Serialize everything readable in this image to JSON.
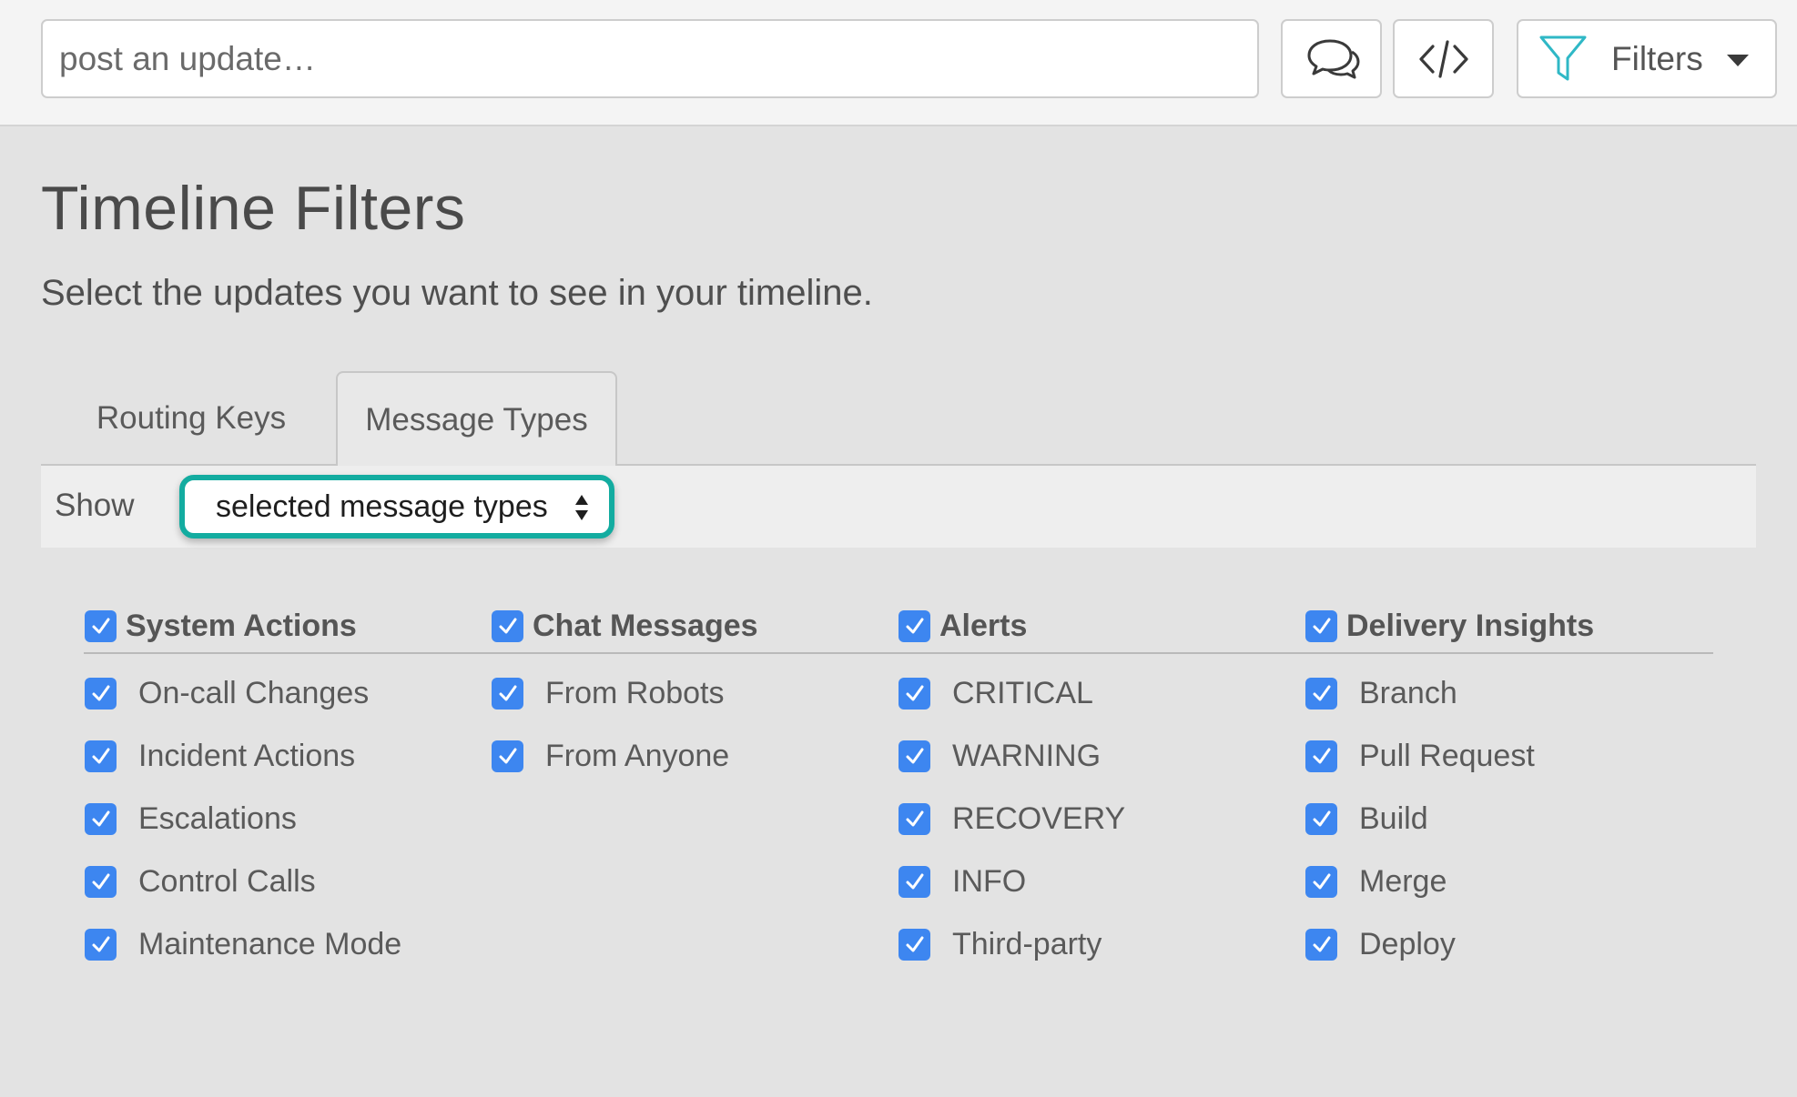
{
  "topbar": {
    "post_placeholder": "post an update…",
    "chat_icon": "chat-bubbles-icon",
    "code_icon": "code-icon",
    "filters_icon": "funnel-icon",
    "filters_label": "Filters"
  },
  "page": {
    "title": "Timeline Filters",
    "subtitle": "Select the updates you want to see in your timeline."
  },
  "tabs": [
    {
      "label": "Routing Keys",
      "active": false
    },
    {
      "label": "Message Types",
      "active": true
    }
  ],
  "show": {
    "label": "Show",
    "selected": "selected message types"
  },
  "groups": [
    {
      "label": "System Actions",
      "checked": true,
      "items": [
        {
          "label": "On-call Changes",
          "checked": true
        },
        {
          "label": "Incident Actions",
          "checked": true
        },
        {
          "label": "Escalations",
          "checked": true
        },
        {
          "label": "Control Calls",
          "checked": true
        },
        {
          "label": "Maintenance Mode",
          "checked": true
        }
      ]
    },
    {
      "label": "Chat Messages",
      "checked": true,
      "items": [
        {
          "label": "From Robots",
          "checked": true
        },
        {
          "label": "From Anyone",
          "checked": true
        }
      ]
    },
    {
      "label": "Alerts",
      "checked": true,
      "items": [
        {
          "label": "CRITICAL",
          "checked": true
        },
        {
          "label": "WARNING",
          "checked": true
        },
        {
          "label": "RECOVERY",
          "checked": true
        },
        {
          "label": "INFO",
          "checked": true
        },
        {
          "label": "Third-party",
          "checked": true
        }
      ]
    },
    {
      "label": "Delivery Insights",
      "checked": true,
      "items": [
        {
          "label": "Branch",
          "checked": true
        },
        {
          "label": "Pull Request",
          "checked": true
        },
        {
          "label": "Build",
          "checked": true
        },
        {
          "label": "Merge",
          "checked": true
        },
        {
          "label": "Deploy",
          "checked": true
        }
      ]
    }
  ],
  "colors": {
    "checkbox": "#3d86f0",
    "highlight_ring": "#13aca0",
    "filter_icon": "#2fb8c6"
  }
}
